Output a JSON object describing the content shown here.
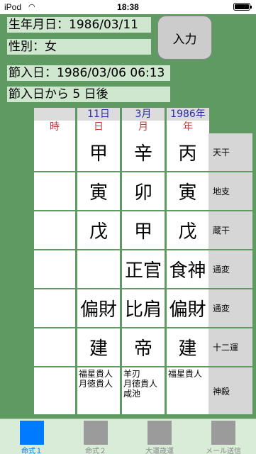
{
  "status": {
    "carrier": "iPod",
    "time": "18:38"
  },
  "info": {
    "birth": "生年月日：1986/03/11",
    "gender": "性別：女",
    "setsu_day": "節入日：1986/03/06 06:13",
    "setsu_after": "節入日から 5 日後"
  },
  "input_button": "入力",
  "table": {
    "top_headers": [
      "",
      "11日",
      "3月",
      "1986年"
    ],
    "low_headers": [
      "時",
      "日",
      "月",
      "年"
    ],
    "rows": [
      {
        "label": "天干",
        "cells": [
          "",
          "甲",
          "辛",
          "丙"
        ]
      },
      {
        "label": "地支",
        "cells": [
          "",
          "寅",
          "卯",
          "寅"
        ]
      },
      {
        "label": "蔵干",
        "cells": [
          "",
          "戊",
          "甲",
          "戊"
        ]
      },
      {
        "label": "通変",
        "cells": [
          "",
          "",
          "正官",
          "食神"
        ]
      },
      {
        "label": "通変",
        "cells": [
          "",
          "偏財",
          "比肩",
          "偏財"
        ]
      },
      {
        "label": "十二運",
        "cells": [
          "",
          "建",
          "帝",
          "建"
        ]
      }
    ],
    "shinsatsu": {
      "label": "神殺",
      "cells": [
        [],
        [
          "福星貴人",
          "月徳貴人"
        ],
        [
          "羊刃",
          "月徳貴人",
          "咸池"
        ],
        [
          "福星貴人"
        ]
      ]
    }
  },
  "tabs": [
    "命式１",
    "命式２",
    "大運歳運",
    "メール送信"
  ],
  "colors": {
    "background": "#5f9a62",
    "info_box": "#cfe6cf",
    "active_tab": "#007aff",
    "header_blue": "#2a2aa8",
    "header_red": "#c23b3b"
  }
}
